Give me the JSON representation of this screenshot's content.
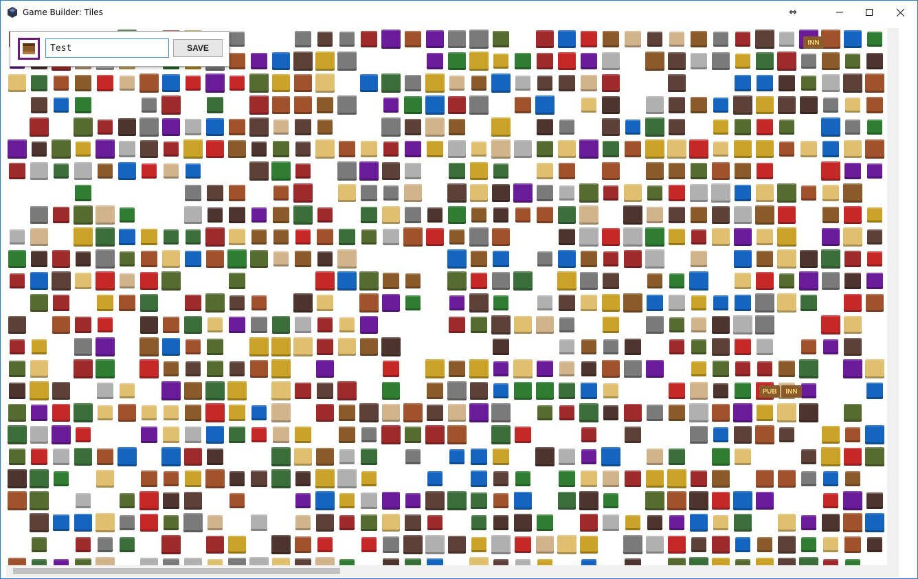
{
  "window": {
    "title": "Game Builder: Tiles",
    "resize_glyph": "⇔",
    "minimize_glyph": "—",
    "maximize_glyph": "☐",
    "close_glyph": "✕"
  },
  "editor": {
    "name_value": "Test",
    "save_label": "SAVE"
  },
  "tileset": {
    "visible_text": [
      "INN",
      "PUB",
      "INN"
    ],
    "palette": [
      "#8b5a2b",
      "#a0522d",
      "#556b2f",
      "#2e7d32",
      "#9e2a2b",
      "#c9a227",
      "#7a7a7a",
      "#5d4037",
      "#d2b48c",
      "#3b6e3b",
      "#b0b0b0",
      "#6a1b9a",
      "#1565c0",
      "#c62828",
      "#e0c070",
      "#4e342e"
    ]
  }
}
